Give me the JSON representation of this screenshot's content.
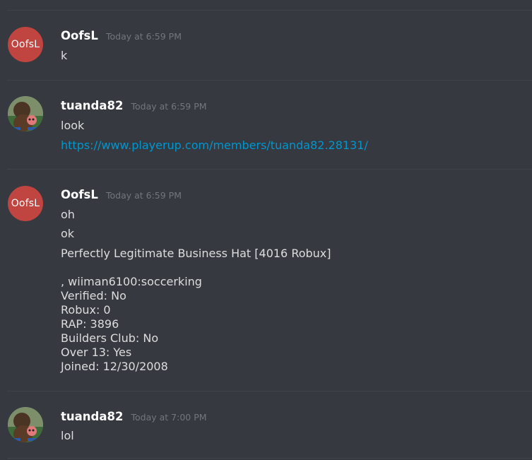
{
  "messages": [
    {
      "username": "OofsL",
      "avatar_text": "OofsL",
      "timestamp": "Today at 6:59 PM",
      "lines": [
        "k"
      ]
    },
    {
      "username": "tuanda82",
      "timestamp": "Today at 6:59 PM",
      "lines": [
        "look"
      ],
      "link": "https://www.playerup.com/members/tuanda82.28131/"
    },
    {
      "username": "OofsL",
      "avatar_text": "OofsL",
      "timestamp": "Today at 6:59 PM",
      "lines": [
        "oh",
        "ok",
        "Perfectly Legitimate Business Hat [4016 Robux]"
      ],
      "details": [
        ", wiiman6100:soccerking",
        "Verified: No",
        "Robux: 0",
        "RAP: 3896",
        "Builders Club: No",
        "Over 13: Yes",
        "Joined: 12/30/2008"
      ]
    },
    {
      "username": "tuanda82",
      "timestamp": "Today at 7:00 PM",
      "lines": [
        "lol"
      ]
    }
  ],
  "colors": {
    "background": "#36393f",
    "username": "#ffffff",
    "timestamp": "#72767d",
    "text": "#dcddde",
    "link": "#0096cf",
    "oofsl_avatar": "#c0443f"
  }
}
